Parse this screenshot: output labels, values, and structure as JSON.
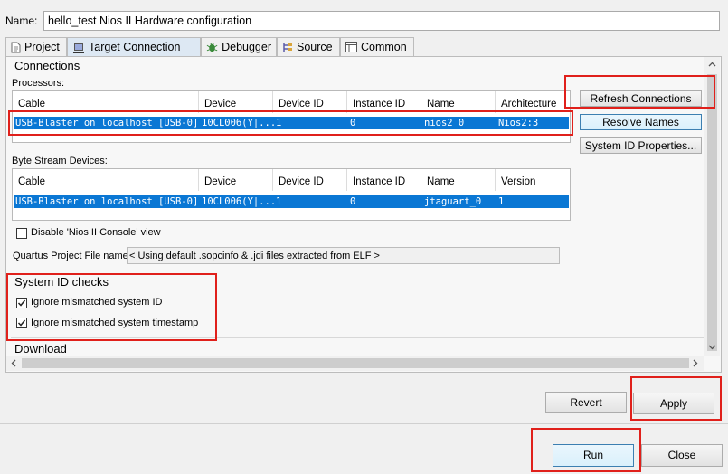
{
  "name_label": "Name:",
  "name_value": "hello_test Nios II Hardware configuration",
  "tabs": [
    {
      "label": "Project",
      "icon": "document-icon"
    },
    {
      "label": "Target Connection",
      "icon": "target-connection-icon"
    },
    {
      "label": "Debugger",
      "icon": "bug-icon"
    },
    {
      "label": "Source",
      "icon": "source-icon"
    },
    {
      "label": "Common",
      "icon": "common-icon"
    }
  ],
  "connections": {
    "title": "Connections",
    "processors_label": "Processors:",
    "processor_headers": [
      "Cable",
      "Device",
      "Device ID",
      "Instance ID",
      "Name",
      "Architecture"
    ],
    "processor_row": [
      "USB-Blaster on localhost [USB-0]",
      "10CL006(Y|...",
      "1",
      "0",
      "nios2_0",
      "Nios2:3"
    ],
    "bytestream_label": "Byte Stream Devices:",
    "bytestream_headers": [
      "Cable",
      "Device",
      "Device ID",
      "Instance ID",
      "Name",
      "Version"
    ],
    "bytestream_row": [
      "USB-Blaster on localhost [USB-0]",
      "10CL006(Y|...",
      "1",
      "0",
      "jtaguart_0",
      "1"
    ],
    "disable_console_label": "Disable 'Nios II Console' view",
    "disable_console_checked": false,
    "quartus_label": "Quartus Project File name:",
    "quartus_value": "< Using default .sopcinfo & .jdi files extracted from ELF >"
  },
  "side_buttons": {
    "refresh": "Refresh Connections",
    "resolve": "Resolve Names",
    "sysid": "System ID Properties..."
  },
  "system_id": {
    "title": "System ID checks",
    "ignore_id_label": "Ignore mismatched system ID",
    "ignore_id_checked": true,
    "ignore_ts_label": "Ignore mismatched system timestamp",
    "ignore_ts_checked": true
  },
  "download_title": "Download",
  "bottom_buttons": {
    "revert": "Revert",
    "apply": "Apply",
    "run": "Run",
    "close": "Close"
  },
  "colors": {
    "selection": "#0a77d4",
    "annotation": "#e0201b"
  }
}
